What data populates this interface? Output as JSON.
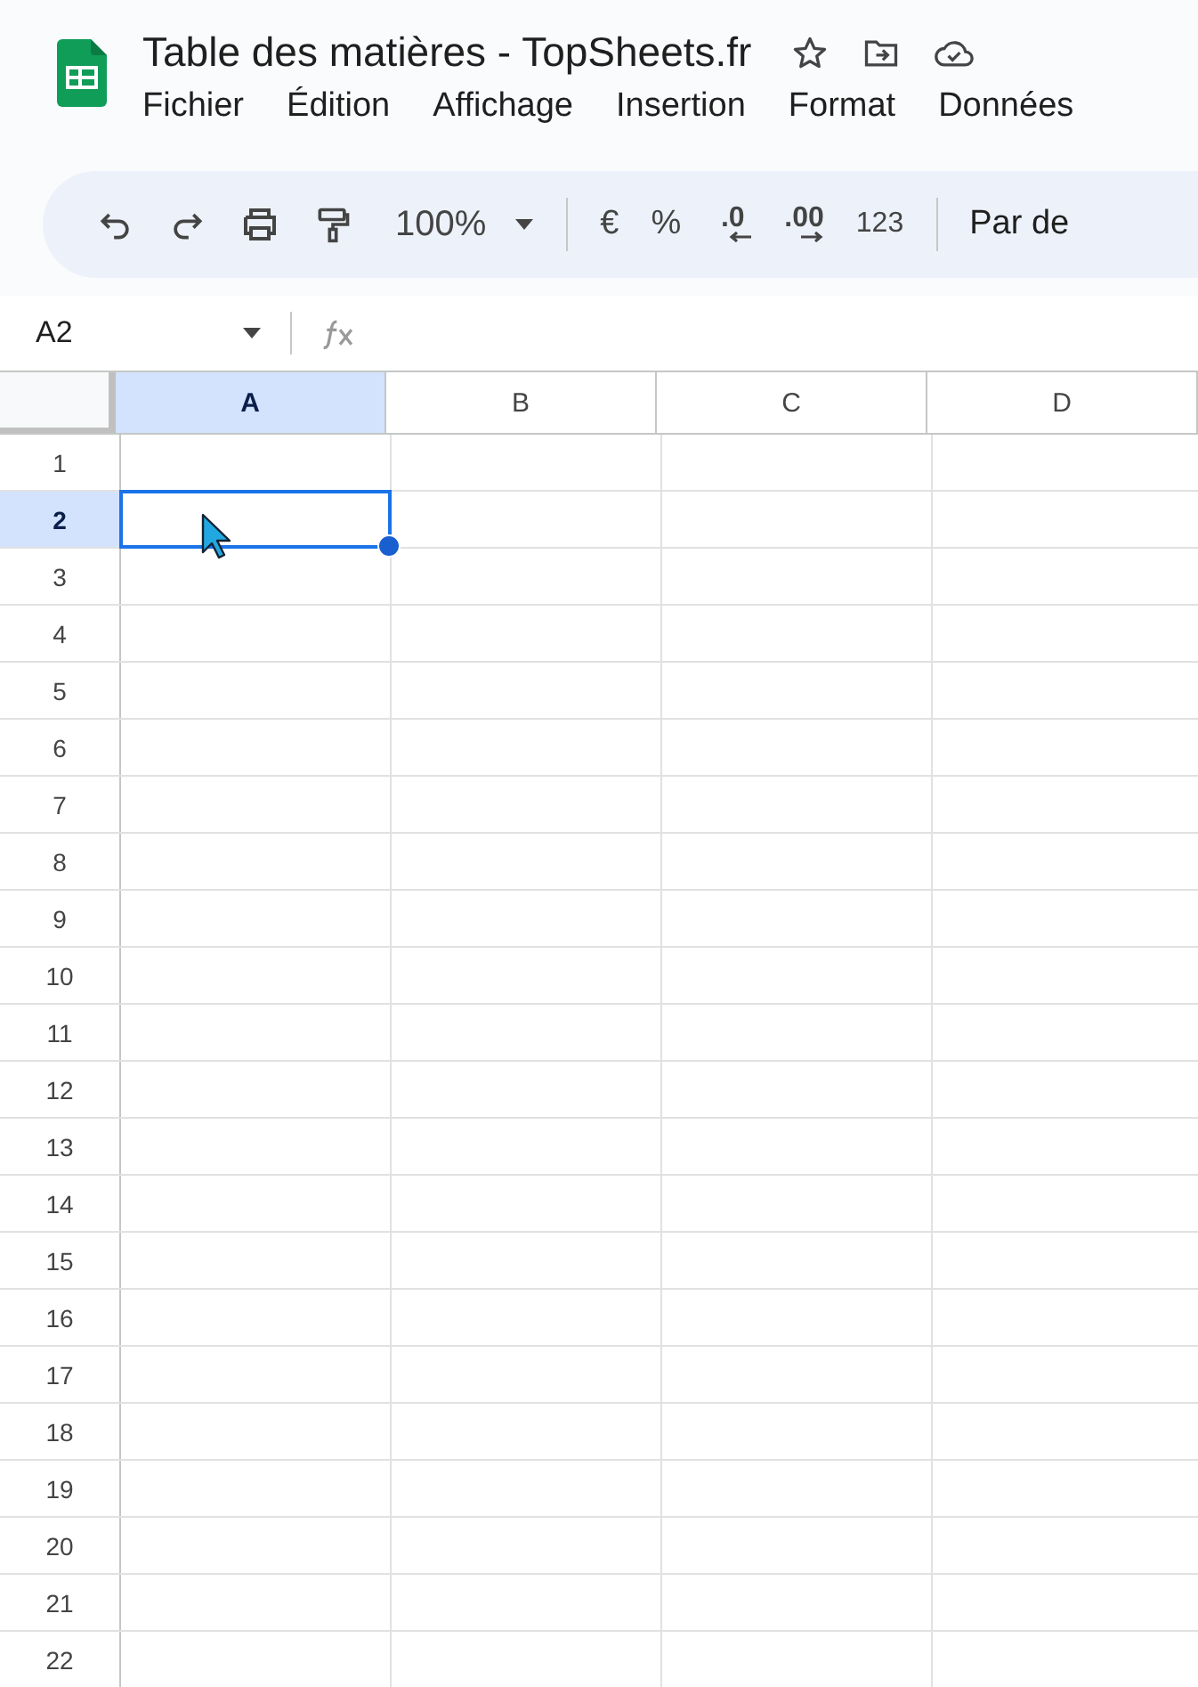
{
  "document": {
    "title": "Table des matières - TopSheets.fr"
  },
  "menu": [
    "Fichier",
    "Édition",
    "Affichage",
    "Insertion",
    "Format",
    "Données"
  ],
  "toolbar": {
    "zoom": "100%",
    "currency": "€",
    "percent": "%",
    "decrease_decimals": ".0",
    "increase_decimals": ".00",
    "number_format": "123",
    "font": "Par de"
  },
  "formula_bar": {
    "name_box": "A2"
  },
  "columns": [
    {
      "label": "A",
      "selected": true
    },
    {
      "label": "B",
      "selected": false
    },
    {
      "label": "C",
      "selected": false
    },
    {
      "label": "D",
      "selected": false
    }
  ],
  "rows": [
    {
      "label": "1",
      "selected": false
    },
    {
      "label": "2",
      "selected": true
    },
    {
      "label": "3",
      "selected": false
    },
    {
      "label": "4",
      "selected": false
    },
    {
      "label": "5",
      "selected": false
    },
    {
      "label": "6",
      "selected": false
    },
    {
      "label": "7",
      "selected": false
    },
    {
      "label": "8",
      "selected": false
    },
    {
      "label": "9",
      "selected": false
    },
    {
      "label": "10",
      "selected": false
    },
    {
      "label": "11",
      "selected": false
    },
    {
      "label": "12",
      "selected": false
    },
    {
      "label": "13",
      "selected": false
    },
    {
      "label": "14",
      "selected": false
    },
    {
      "label": "15",
      "selected": false
    },
    {
      "label": "16",
      "selected": false
    },
    {
      "label": "17",
      "selected": false
    },
    {
      "label": "18",
      "selected": false
    },
    {
      "label": "19",
      "selected": false
    },
    {
      "label": "20",
      "selected": false
    },
    {
      "label": "21",
      "selected": false
    },
    {
      "label": "22",
      "selected": false
    }
  ]
}
